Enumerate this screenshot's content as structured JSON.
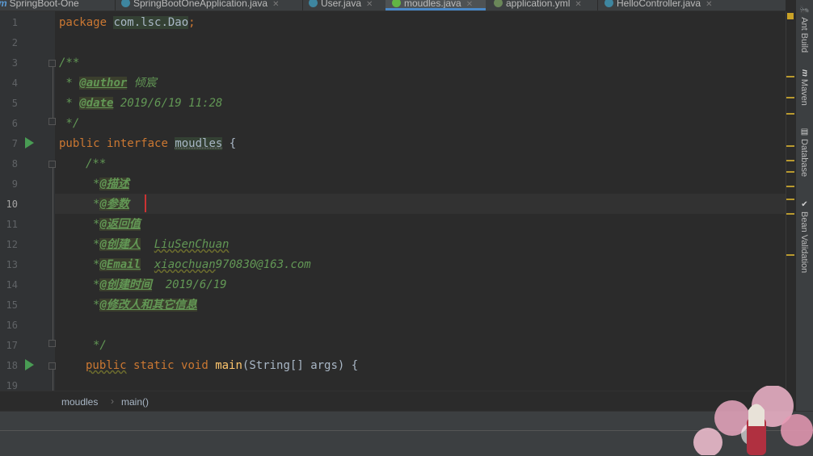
{
  "tabs": [
    {
      "label": "SpringBoot-One",
      "icon": "maven-module-icon",
      "active": false
    },
    {
      "label": "SpringBootOneApplication.java",
      "icon": "spring-class-icon",
      "active": false
    },
    {
      "label": "User.java",
      "icon": "class-icon",
      "active": false
    },
    {
      "label": "moudles.java",
      "icon": "interface-icon",
      "active": true
    },
    {
      "label": "application.yml",
      "icon": "spring-config-icon",
      "active": false
    },
    {
      "label": "HelloController.java",
      "icon": "class-icon",
      "active": false
    }
  ],
  "line_numbers": [
    "1",
    "2",
    "3",
    "4",
    "5",
    "6",
    "7",
    "8",
    "9",
    "10",
    "11",
    "12",
    "13",
    "14",
    "15",
    "16",
    "17",
    "18",
    "19"
  ],
  "current_line": "10",
  "code": {
    "l1_kw": "package",
    "l1_pkg": "com.lsc.Dao",
    "l1_semi": ";",
    "l3": "/**",
    "l4_star": " * ",
    "l4_tag": "@author",
    "l4_val": " 倾宸",
    "l5_star": " * ",
    "l5_tag": "@date",
    "l5_val": " 2019/6/19 11:28",
    "l6": " */",
    "l7_public": "public",
    "l7_interface": "interface",
    "l7_name": "moudles",
    "l7_brace": " {",
    "l8": "/**",
    "l9_star": "*",
    "l9_tag": "@描述",
    "l10_star": "*",
    "l10_tag": "@参数",
    "l11_star": "*",
    "l11_tag": "@返回值",
    "l12_star": "*",
    "l12_tag": "@创建人",
    "l12_val": "LiuSenChuan",
    "l13_star": "*",
    "l13_tag": "@Email",
    "l13_val_a": "xiaochuan",
    "l13_val_b": "970830@163.com",
    "l14_star": "*",
    "l14_tag": "@创建时间",
    "l14_val": "2019/6/19",
    "l15_star": "*",
    "l15_tag": "@修改人和其它信息",
    "l17": "*/",
    "l18_public": "public",
    "l18_static": "static",
    "l18_void": "void",
    "l18_main": "main",
    "l18_params": "(String[] args) {"
  },
  "breadcrumb": {
    "items": [
      "moudles",
      "main()"
    ]
  },
  "right_panel": {
    "tools": [
      {
        "label": "Ant Build",
        "icon": "ant-icon"
      },
      {
        "label": "Maven",
        "icon": "maven-icon"
      },
      {
        "label": "Database",
        "icon": "database-icon"
      },
      {
        "label": "Bean Validation",
        "icon": "bean-validation-icon"
      }
    ]
  },
  "colors": {
    "accent": "#4a88c7",
    "run": "#499c54",
    "keyword": "#cc7832",
    "doc_comment": "#629755",
    "caret": "#cc3333"
  }
}
